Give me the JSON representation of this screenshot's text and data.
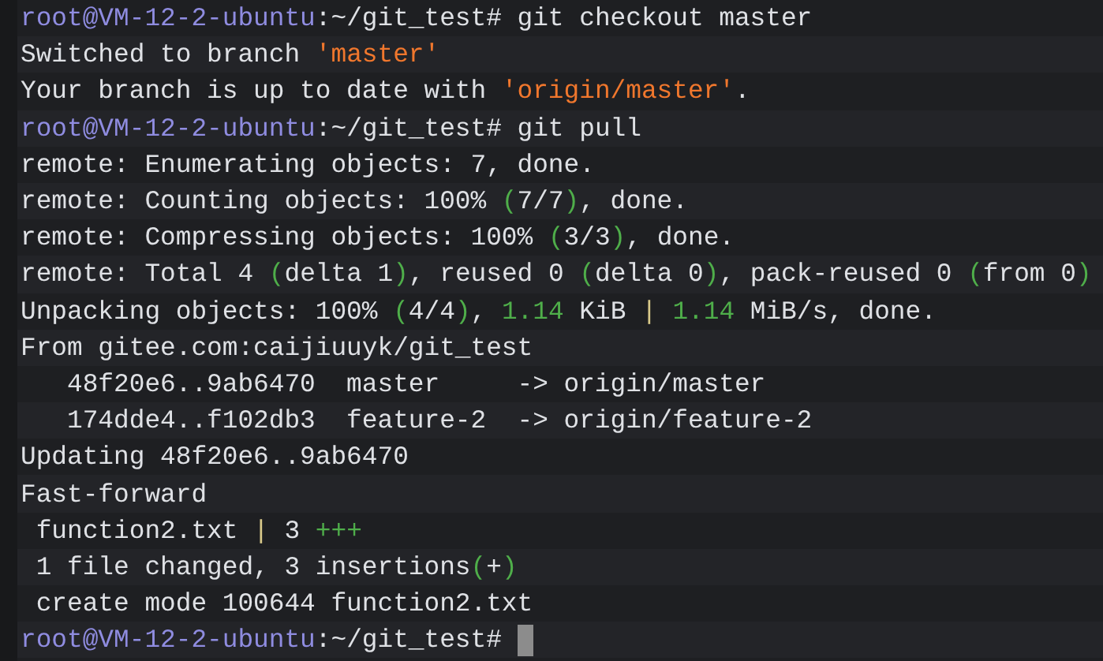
{
  "terminal": {
    "lines": [
      {
        "cursor": false,
        "segments": [
          {
            "kind": "host",
            "text": "root@VM-12-2-ubuntu"
          },
          {
            "kind": "plain",
            "text": ":~/git_test# git checkout master"
          }
        ]
      },
      {
        "cursor": false,
        "segments": [
          {
            "kind": "plain",
            "text": "Switched to branch "
          },
          {
            "kind": "string",
            "text": "'master'"
          }
        ]
      },
      {
        "cursor": false,
        "segments": [
          {
            "kind": "plain",
            "text": "Your branch is up to date with "
          },
          {
            "kind": "string",
            "text": "'origin/master'"
          },
          {
            "kind": "plain",
            "text": "."
          }
        ]
      },
      {
        "cursor": false,
        "segments": [
          {
            "kind": "host",
            "text": "root@VM-12-2-ubuntu"
          },
          {
            "kind": "plain",
            "text": ":~/git_test# git pull"
          }
        ]
      },
      {
        "cursor": false,
        "segments": [
          {
            "kind": "plain",
            "text": "remote: Enumerating objects: 7, done."
          }
        ]
      },
      {
        "cursor": false,
        "segments": [
          {
            "kind": "plain",
            "text": "remote: Counting objects: 100% "
          },
          {
            "kind": "paren",
            "text": "("
          },
          {
            "kind": "plain",
            "text": "7/7"
          },
          {
            "kind": "paren",
            "text": ")"
          },
          {
            "kind": "plain",
            "text": ", done."
          }
        ]
      },
      {
        "cursor": false,
        "segments": [
          {
            "kind": "plain",
            "text": "remote: Compressing objects: 100% "
          },
          {
            "kind": "paren",
            "text": "("
          },
          {
            "kind": "plain",
            "text": "3/3"
          },
          {
            "kind": "paren",
            "text": ")"
          },
          {
            "kind": "plain",
            "text": ", done."
          }
        ]
      },
      {
        "cursor": false,
        "segments": [
          {
            "kind": "plain",
            "text": "remote: Total 4 "
          },
          {
            "kind": "paren",
            "text": "("
          },
          {
            "kind": "plain",
            "text": "delta 1"
          },
          {
            "kind": "paren",
            "text": ")"
          },
          {
            "kind": "plain",
            "text": ", reused 0 "
          },
          {
            "kind": "paren",
            "text": "("
          },
          {
            "kind": "plain",
            "text": "delta 0"
          },
          {
            "kind": "paren",
            "text": ")"
          },
          {
            "kind": "plain",
            "text": ", pack-reused 0 "
          },
          {
            "kind": "paren",
            "text": "("
          },
          {
            "kind": "plain",
            "text": "from 0"
          },
          {
            "kind": "paren",
            "text": ")"
          }
        ]
      },
      {
        "cursor": false,
        "segments": [
          {
            "kind": "plain",
            "text": "Unpacking objects: 100% "
          },
          {
            "kind": "paren",
            "text": "("
          },
          {
            "kind": "plain",
            "text": "4/4"
          },
          {
            "kind": "paren",
            "text": ")"
          },
          {
            "kind": "plain",
            "text": ", "
          },
          {
            "kind": "number",
            "text": "1.14"
          },
          {
            "kind": "plain",
            "text": " KiB "
          },
          {
            "kind": "pipe",
            "text": "|"
          },
          {
            "kind": "number",
            "text": " 1.14"
          },
          {
            "kind": "plain",
            "text": " MiB/s, done."
          }
        ]
      },
      {
        "cursor": false,
        "segments": [
          {
            "kind": "plain",
            "text": "From gitee.com:caijiuuyk/git_test"
          }
        ]
      },
      {
        "cursor": false,
        "segments": [
          {
            "kind": "plain",
            "text": "   48f20e6..9ab6470  master     -> origin/master"
          }
        ]
      },
      {
        "cursor": false,
        "segments": [
          {
            "kind": "plain",
            "text": "   174dde4..f102db3  feature-2  -> origin/feature-2"
          }
        ]
      },
      {
        "cursor": false,
        "segments": [
          {
            "kind": "plain",
            "text": "Updating 48f20e6..9ab6470"
          }
        ]
      },
      {
        "cursor": false,
        "segments": [
          {
            "kind": "plain",
            "text": "Fast-forward"
          }
        ]
      },
      {
        "cursor": false,
        "segments": [
          {
            "kind": "plain",
            "text": " function2.txt "
          },
          {
            "kind": "pipe",
            "text": "|"
          },
          {
            "kind": "plain",
            "text": " 3 "
          },
          {
            "kind": "number",
            "text": "+++"
          }
        ]
      },
      {
        "cursor": false,
        "segments": [
          {
            "kind": "plain",
            "text": " 1 file changed, 3 insertions"
          },
          {
            "kind": "paren",
            "text": "("
          },
          {
            "kind": "plain",
            "text": "+"
          },
          {
            "kind": "paren",
            "text": ")"
          }
        ]
      },
      {
        "cursor": false,
        "segments": [
          {
            "kind": "plain",
            "text": " create mode 100644 function2.txt"
          }
        ]
      },
      {
        "cursor": true,
        "segments": [
          {
            "kind": "host",
            "text": "root@VM-12-2-ubuntu"
          },
          {
            "kind": "plain",
            "text": ":~/git_test# "
          }
        ]
      }
    ]
  }
}
